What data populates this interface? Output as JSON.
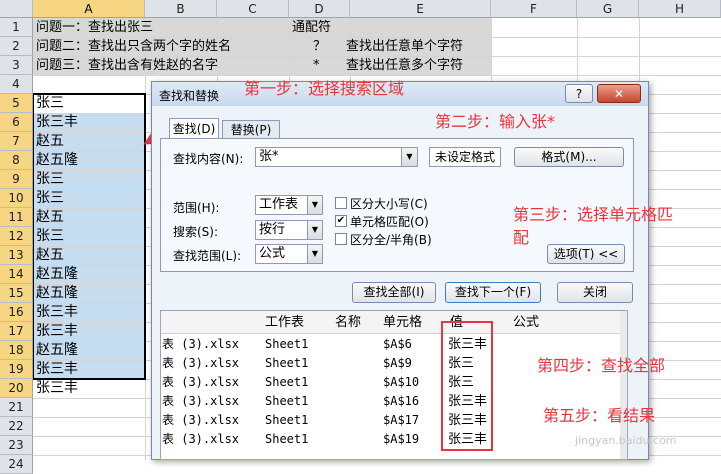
{
  "columns": [
    "A",
    "B",
    "C",
    "D",
    "E",
    "F",
    "G",
    "H"
  ],
  "rows": [
    "1",
    "2",
    "3",
    "4",
    "5",
    "6",
    "7",
    "8",
    "9",
    "10",
    "11",
    "12",
    "13",
    "14",
    "15",
    "16",
    "17",
    "18",
    "19",
    "20",
    "21",
    "22",
    "23",
    "24"
  ],
  "questions": [
    {
      "text": "问题一：查找出张三",
      "wildcard": "通配符",
      "desc": ""
    },
    {
      "text": "问题二：查找出只含两个字的姓名",
      "wildcard": "？",
      "desc": "查找出任意单个字符"
    },
    {
      "text": "问题三：查找出含有姓赵的名字",
      "wildcard": "*",
      "desc": "查找出任意多个字符"
    }
  ],
  "names": [
    "张三",
    "张三丰",
    "赵五",
    "赵五隆",
    "张三",
    "张三",
    "赵五",
    "张三",
    "赵五",
    "赵五隆",
    "赵五隆",
    "张三丰",
    "张三丰",
    "赵五隆",
    "张三丰",
    "张三丰"
  ],
  "dialog": {
    "title": "查找和替换",
    "help": "?",
    "close": "✕",
    "tab_find": "查找(D)",
    "tab_replace": "替换(P)",
    "find_label": "查找内容(N):",
    "find_value": "张*",
    "format_status": "未设定格式",
    "format_button": "格式(M)...",
    "scope_label": "范围(H):",
    "scope_value": "工作表",
    "search_label": "搜索(S):",
    "search_value": "按行",
    "lookin_label": "查找范围(L):",
    "lookin_value": "公式",
    "match_case": "区分大小写(C)",
    "match_cell": "单元格匹配(O)",
    "match_width": "区分全/半角(B)",
    "options_button": "选项(T) <<",
    "find_all": "查找全部(I)",
    "find_next": "查找下一个(F)",
    "close_button": "关闭",
    "results_headers": [
      "工作表",
      "名称",
      "单元格",
      "值",
      "公式"
    ],
    "results": [
      {
        "book": "表 (3).xlsx",
        "sheet": "Sheet1",
        "name": "",
        "cell": "$A$6",
        "value": "张三丰"
      },
      {
        "book": "表 (3).xlsx",
        "sheet": "Sheet1",
        "name": "",
        "cell": "$A$9",
        "value": "张三"
      },
      {
        "book": "表 (3).xlsx",
        "sheet": "Sheet1",
        "name": "",
        "cell": "$A$10",
        "value": "张三"
      },
      {
        "book": "表 (3).xlsx",
        "sheet": "Sheet1",
        "name": "",
        "cell": "$A$16",
        "value": "张三丰"
      },
      {
        "book": "表 (3).xlsx",
        "sheet": "Sheet1",
        "name": "",
        "cell": "$A$17",
        "value": "张三丰"
      },
      {
        "book": "表 (3).xlsx",
        "sheet": "Sheet1",
        "name": "",
        "cell": "$A$19",
        "value": "张三丰"
      }
    ]
  },
  "annotations": {
    "step1": "第一步：选择搜索区域",
    "step2": "第二步：输入张*",
    "step3a": "第三步：选择单元格匹",
    "step3b": "配",
    "step4": "第四步：查找全部",
    "step5": "第五步：看结果"
  },
  "watermark": "jingyan.baidu.com",
  "colors": {
    "annotation": "#e8353d",
    "selection": "#c6ddf0",
    "header_selected": "#f6d583"
  }
}
